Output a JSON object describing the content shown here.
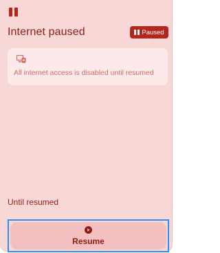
{
  "status": {
    "title": "Internet paused",
    "badge_label": "Paused",
    "icon": "pause-icon"
  },
  "info": {
    "icon": "device-blocked-icon",
    "message": "All internet access is disabled until resumed"
  },
  "duration": {
    "label": "Until resumed"
  },
  "actions": {
    "resume_label": "Resume",
    "resume_icon": "play-icon"
  },
  "colors": {
    "background": "#f8d7d7",
    "accent": "#b3261e",
    "text": "#8f1d17",
    "muted_text": "#d46a63",
    "panel": "#fce9e9",
    "button": "#f3bfbf",
    "focus_ring": "#2f8ff0"
  }
}
